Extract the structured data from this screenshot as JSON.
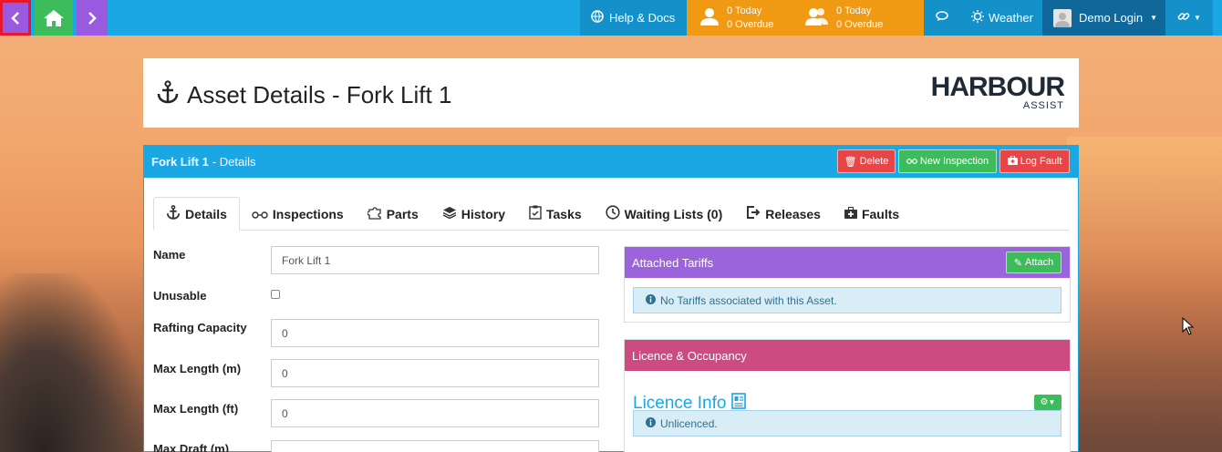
{
  "topbar": {
    "help": "Help & Docs",
    "today1": {
      "today": "0 Today",
      "overdue": "0 Overdue"
    },
    "today2": {
      "today": "0 Today",
      "overdue": "0 Overdue"
    },
    "weather": "Weather",
    "login": "Demo Login"
  },
  "header": {
    "title": "Asset Details - Fork Lift 1",
    "logo_main": "HARBOUR",
    "logo_sub": "ASSIST"
  },
  "card": {
    "asset_name": "Fork Lift 1",
    "subtitle": "- Details",
    "delete_label": "Delete",
    "new_inspection_label": "New Inspection",
    "log_fault_label": "Log Fault"
  },
  "tabs": [
    "Details",
    "Inspections",
    "Parts",
    "History",
    "Tasks",
    "Waiting Lists (0)",
    "Releases",
    "Faults"
  ],
  "form": {
    "name_label": "Name",
    "name_value": "Fork Lift 1",
    "unusable_label": "Unusable",
    "rafting_label": "Rafting Capacity",
    "rafting_value": "0",
    "maxlen_m_label": "Max Length (m)",
    "maxlen_m_value": "0",
    "maxlen_ft_label": "Max Length (ft)",
    "maxlen_ft_value": "0",
    "maxdraft_label": "Max Draft (m)"
  },
  "tariffs": {
    "title": "Attached Tariffs",
    "attach_label": "Attach",
    "empty_msg": "No Tariffs associated with this Asset."
  },
  "licence": {
    "header": "Licence & Occupancy",
    "info_title": "Licence Info",
    "status_msg": "Unlicenced."
  },
  "colors": {
    "topbar": "#1aa7e4",
    "accent_orange": "#f09a14",
    "purple": "#9b64dc",
    "pink": "#cc4c82",
    "green": "#3cbc5a",
    "red": "#e84646"
  }
}
